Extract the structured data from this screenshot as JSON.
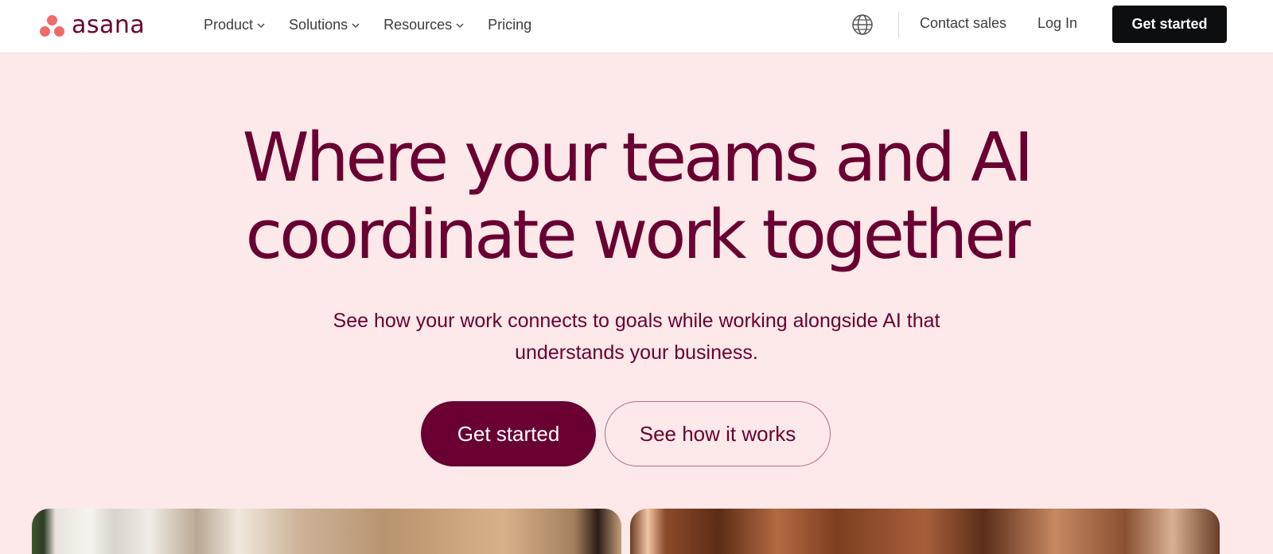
{
  "brand": {
    "name": "asana",
    "accent": "#690031",
    "logo_color": "#f06a6a"
  },
  "nav": {
    "items": [
      {
        "label": "Product",
        "dropdown": true
      },
      {
        "label": "Solutions",
        "dropdown": true
      },
      {
        "label": "Resources",
        "dropdown": true
      },
      {
        "label": "Pricing",
        "dropdown": false
      }
    ],
    "contact_label": "Contact sales",
    "login_label": "Log In",
    "cta_label": "Get started"
  },
  "hero": {
    "headline_line1": "Where your teams and AI",
    "headline_line2": "coordinate work together",
    "subtitle": "See how your work connects to goals while working alongside AI that understands your business.",
    "primary_button": "Get started",
    "secondary_button": "See how it works"
  },
  "icons": [
    "globe-icon",
    "chevron-down-icon"
  ]
}
